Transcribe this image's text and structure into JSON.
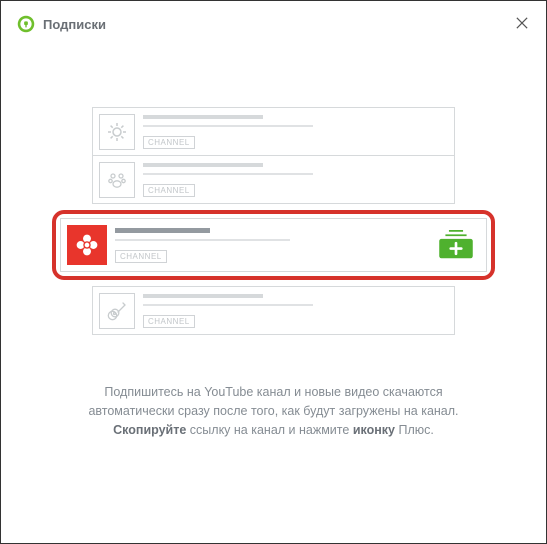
{
  "header": {
    "title": "Подписки"
  },
  "cards": {
    "badge_label": "CHANNEL",
    "icons": [
      "sun",
      "paw",
      "flower",
      "guitar"
    ],
    "active_index": 2
  },
  "help": {
    "line1": "Подпишитесь на YouTube канал и новые видео скачаются",
    "line2": "автоматически сразу после того, как будут загружены на канал.",
    "bold1": "Скопируйте",
    "mid": " ссылку на канал и нажмите ",
    "bold2": "иконку",
    "tail": " Плюс."
  }
}
